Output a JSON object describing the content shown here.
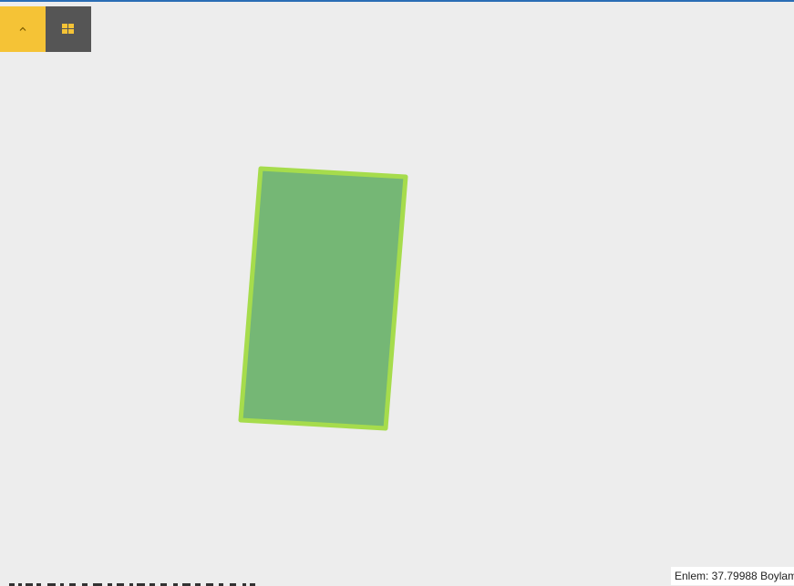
{
  "map": {
    "background_color": "#ededed",
    "accent_border_color": "#2a6db5"
  },
  "toolbar": {
    "collapse_button": {
      "icon": "chevron-up-icon",
      "color": "#f5c336",
      "icon_color": "#7a5a00"
    },
    "layers_button": {
      "icon": "grid-layers-icon",
      "color": "#555555",
      "icon_color": "#f5c336"
    }
  },
  "parcel": {
    "fill_color": "#75b775",
    "stroke_color": "#a6dc4c"
  },
  "coordinates": {
    "readout": "Enlem: 37.79988 Boylam"
  }
}
